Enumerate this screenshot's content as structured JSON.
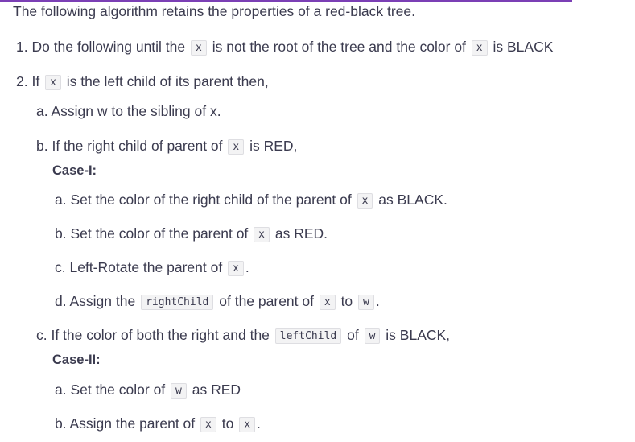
{
  "intro": "The following algorithm retains the properties of a red-black tree.",
  "step1": {
    "a": "1. Do the following until the",
    "code1": "x",
    "b": "is not the root of the tree and the color of",
    "code2": "x",
    "c": "is BLACK"
  },
  "step2": {
    "a": "2. If",
    "code1": "x",
    "b": "is the left child of its parent then,"
  },
  "step2a": "a. Assign w to the sibling of x.",
  "step2b": {
    "a": "b. If the right child of parent of",
    "code1": "x",
    "b": "is RED,"
  },
  "case1": {
    "title": "Case-I:",
    "s1": {
      "a": "a. Set the color of the right child of the parent of",
      "code1": "x",
      "b": "as BLACK."
    },
    "s2": {
      "a": "b. Set the color of the parent of",
      "code1": "x",
      "b": "as RED."
    },
    "s3": {
      "a": "c. Left-Rotate the parent of",
      "code1": "x",
      "b": "."
    },
    "s4": {
      "a": "d. Assign the",
      "code1": "rightChild",
      "b": "of the parent of",
      "code2": "x",
      "c": "to",
      "code3": "w",
      "d": "."
    }
  },
  "step2c": {
    "a": "c. If the color of both the right and the",
    "code1": "leftChild",
    "b": "of",
    "code2": "w",
    "c": "is BLACK,"
  },
  "case2": {
    "title": "Case-II:",
    "s1": {
      "a": "a. Set the color of",
      "code1": "w",
      "b": "as RED"
    },
    "s2": {
      "a": "b. Assign the parent of",
      "code1": "x",
      "b": "to",
      "code2": "x",
      "c": "."
    }
  }
}
